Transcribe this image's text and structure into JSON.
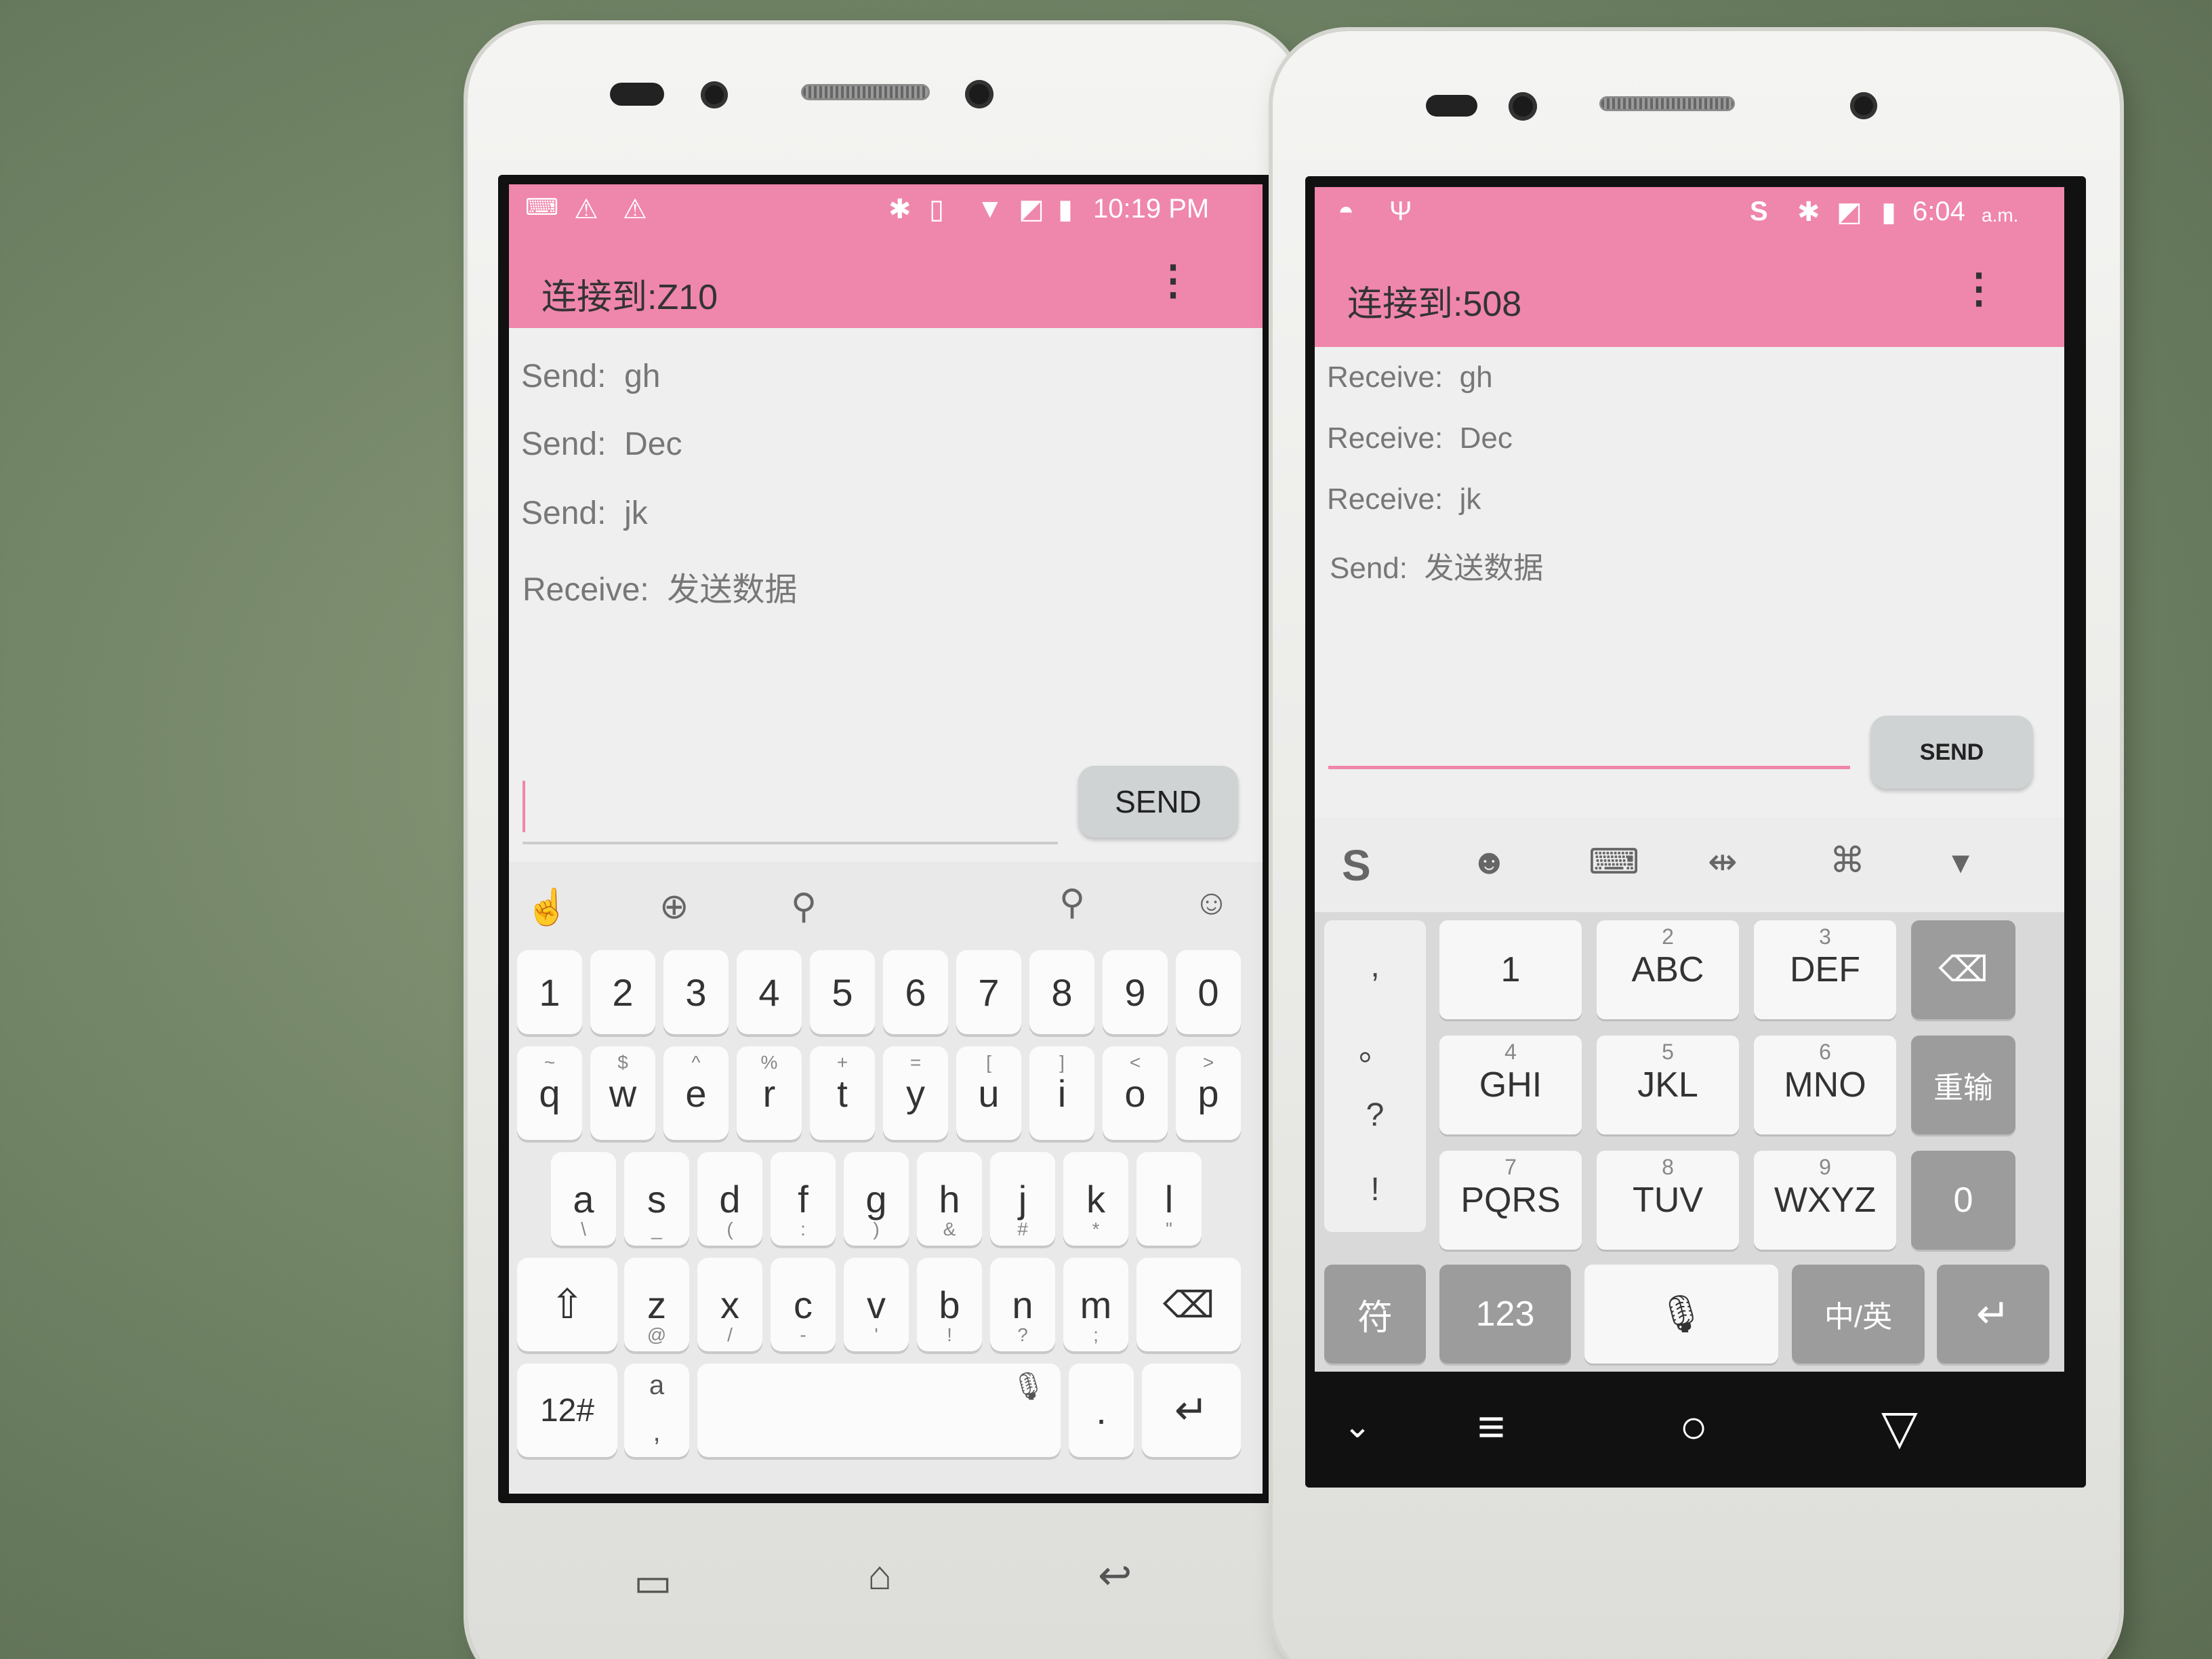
{
  "left_phone": {
    "status_time": "10:19 PM",
    "title": "连接到:Z10",
    "overflow_glyph": "⋮",
    "messages": [
      {
        "kind": "Send:",
        "text": "gh"
      },
      {
        "kind": "Send:",
        "text": "Dec"
      },
      {
        "kind": "Send:",
        "text": "jk"
      },
      {
        "kind": "Receive:",
        "text": "发送数据"
      }
    ],
    "send_label": "SEND",
    "keyboard": {
      "numbers": [
        "1",
        "2",
        "3",
        "4",
        "5",
        "6",
        "7",
        "8",
        "9",
        "0"
      ],
      "row1": [
        [
          "q",
          "~"
        ],
        [
          "w",
          "$"
        ],
        [
          "e",
          "^"
        ],
        [
          "r",
          "%"
        ],
        [
          "t",
          "+"
        ],
        [
          "y",
          "="
        ],
        [
          "u",
          "["
        ],
        [
          "i",
          "]"
        ],
        [
          "o",
          "<"
        ],
        [
          "p",
          ">"
        ]
      ],
      "row2": [
        [
          "a",
          "\\"
        ],
        [
          "s",
          "_"
        ],
        [
          "d",
          "("
        ],
        [
          "f",
          ":"
        ],
        [
          "g",
          ")"
        ],
        [
          "h",
          "&"
        ],
        [
          "j",
          "#"
        ],
        [
          "k",
          "*"
        ],
        [
          "l",
          "\""
        ]
      ],
      "row3": [
        [
          "z",
          "@"
        ],
        [
          "x",
          "/"
        ],
        [
          "c",
          "-"
        ],
        [
          "v",
          "'"
        ],
        [
          "b",
          "!"
        ],
        [
          "n",
          "?"
        ],
        [
          "m",
          ";"
        ]
      ],
      "key_12": "12#",
      "key_period": ".",
      "key_lang_top": "a",
      "key_lang_bottom": ","
    },
    "hw_keys": [
      "menu-key",
      "home-key",
      "back-key"
    ]
  },
  "right_phone": {
    "status_time": "6:04",
    "status_ampm": "a.m.",
    "title": "连接到:508",
    "overflow_glyph": "⋮",
    "messages": [
      {
        "kind": "Receive:",
        "text": "gh"
      },
      {
        "kind": "Receive:",
        "text": "Dec"
      },
      {
        "kind": "Receive:",
        "text": "jk"
      },
      {
        "kind": "Send:",
        "text": "发送数据"
      }
    ],
    "send_label": "SEND",
    "keyboard": {
      "punctuation": [
        ",",
        "。",
        "?",
        "!"
      ],
      "keys": [
        {
          "num": "",
          "label": "1"
        },
        {
          "num": "2",
          "label": "ABC"
        },
        {
          "num": "3",
          "label": "DEF"
        },
        {
          "num": "4",
          "label": "GHI"
        },
        {
          "num": "5",
          "label": "JKL"
        },
        {
          "num": "6",
          "label": "MNO"
        },
        {
          "num": "7",
          "label": "PQRS"
        },
        {
          "num": "8",
          "label": "TUV"
        },
        {
          "num": "9",
          "label": "WXYZ"
        }
      ],
      "key_reset": "重输",
      "key_zero": "0",
      "key_symbols": "符",
      "key_123": "123",
      "key_lang": "中/英"
    }
  },
  "colors": {
    "appbar_pink": "#ef86ab",
    "send_button_gray": "#cfd3d4",
    "input_underline_pink": "#ef86ab"
  }
}
